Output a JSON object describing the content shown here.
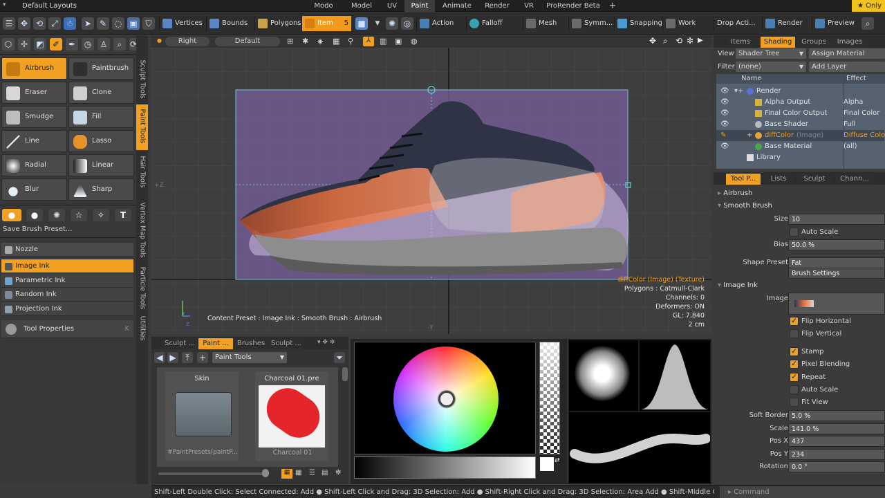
{
  "menubar": {
    "layout_title": "Default Layouts",
    "tabs": [
      "Modo",
      "Model",
      "UV",
      "Paint",
      "Animate",
      "Render",
      "VR",
      "ProRender Beta"
    ],
    "active_tab": "Paint",
    "add_tab": "+",
    "right_label": "Only"
  },
  "toolbar": {
    "buttons": [
      "Vertices",
      "Bounds",
      "Polygons",
      "Item",
      "Action",
      "Falloff",
      "Mesh C ...",
      "Symm...",
      "Snapping",
      "Work Pl...",
      "Drop Acti...",
      "Render",
      "Preview"
    ],
    "item_badge": "5"
  },
  "left": {
    "tools": [
      "Airbrush",
      "Paintbrush",
      "Eraser",
      "Clone",
      "Smudge",
      "Fill",
      "Line",
      "Lasso",
      "Radial Grad...",
      "Linear Grad...",
      "Blur",
      "Sharp"
    ],
    "save_preset": "Save Brush Preset...",
    "nozzle": "Nozzle",
    "inks": [
      "Image Ink",
      "Parametric Ink",
      "Random Ink",
      "Projection Ink"
    ],
    "tool_properties": "Tool Properties",
    "tool_properties_key": "K"
  },
  "vtabs": [
    "Sculpt Tools",
    "Paint Tools",
    "Hair Tools",
    "Vertex Map Tools",
    "Particle Tools",
    "Utilities"
  ],
  "viewport": {
    "view_name": "Right",
    "shading": "Default",
    "content_preset": "Content Preset : Image Ink : Smooth Brush : Airbrush",
    "info": [
      "diffColor (Image) (Texture)",
      "Polygons : Catmull-Clark",
      "Channels: 0",
      "Deformers: ON",
      "GL: 7,840",
      "2 cm"
    ],
    "axis_z_left": "+Z",
    "axis_y_bottom": "-Y",
    "axis_y_label": "Y",
    "axis_z_label": "Z"
  },
  "presets": {
    "tabs": [
      "Sculpt ...",
      "Paint ...",
      "Brushes",
      "Sculpt ..."
    ],
    "dropdown": "Paint Tools",
    "items": [
      {
        "title": "Skin",
        "subtitle": "#PaintPresets(paintP..."
      },
      {
        "title": "Charcoal 01.pre",
        "subtitle": "Charcoal 01"
      }
    ]
  },
  "shading": {
    "tabs": [
      "Items",
      "Shading",
      "Groups",
      "Images"
    ],
    "view_label": "View",
    "view_value": "Shader Tree",
    "assign": "Assign Material",
    "filter_label": "Filter",
    "filter_value": "(none)",
    "add_layer": "Add Layer",
    "col_name": "Name",
    "col_effect": "Effect",
    "rows": [
      {
        "name": "Render",
        "effect": ""
      },
      {
        "name": "Alpha Output",
        "effect": "Alpha"
      },
      {
        "name": "Final Color Output",
        "effect": "Final Color"
      },
      {
        "name": "Base Shader",
        "effect": "Full Shading"
      },
      {
        "name": "diffColor",
        "suffix": "(Image)",
        "effect": "Diffuse Color"
      },
      {
        "name": "Base Material",
        "effect": "(all)"
      },
      {
        "name": "Library",
        "effect": ""
      }
    ]
  },
  "props": {
    "tabs": [
      "Tool P...",
      "Lists",
      "Sculpt",
      "Chann..."
    ],
    "airbrush": "Airbrush",
    "smooth_brush": "Smooth Brush",
    "size_label": "Size",
    "size_value": "10",
    "auto_scale": "Auto Scale",
    "bias_label": "Bias",
    "bias_value": "50.0 %",
    "shape_label": "Shape Preset",
    "shape_value": "Fat",
    "brush_settings": "Brush Settings",
    "image_ink": "Image Ink",
    "image_label": "Image",
    "flip_h": "Flip Horizontal",
    "flip_v": "Flip Vertical",
    "stamp": "Stamp",
    "pixel_blending": "Pixel Blending",
    "repeat": "Repeat",
    "auto_scale2": "Auto Scale",
    "fit_view": "Fit View",
    "soft_border_label": "Soft Border",
    "soft_border_value": "5.0 %",
    "scale_label": "Scale",
    "scale_value": "141.0 %",
    "posx_label": "Pos X",
    "posx_value": "437",
    "posy_label": "Pos Y",
    "posy_value": "234",
    "rotation_label": "Rotation",
    "rotation_value": "0.0 °",
    "command": "Command"
  },
  "statusbar": {
    "text": "Shift-Left Double Click: Select Connected: Add ● Shift-Left Click and Drag: 3D Selection: Add ● Shift-Right Click and Drag: 3D Selection: Area Add ● Shift-Middle Click and Dr"
  },
  "colors": {
    "accent": "#f2a021",
    "bg": "#3b3b3b",
    "selection_box": "#7b5fa0"
  }
}
